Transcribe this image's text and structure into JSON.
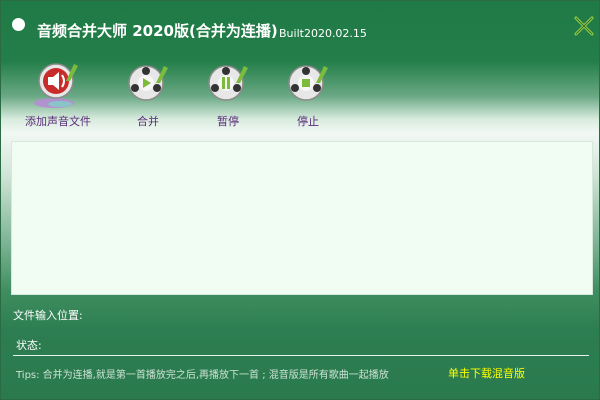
{
  "window": {
    "title": "音频合并大师 2020版(合并为连播)",
    "build": "Built2020.02.15"
  },
  "toolbar": {
    "items": [
      {
        "label": "添加声音文件",
        "icon": "speaker-icon"
      },
      {
        "label": "合并",
        "icon": "merge-play-icon"
      },
      {
        "label": "暂停",
        "icon": "pause-icon"
      },
      {
        "label": "停止",
        "icon": "stop-icon"
      }
    ]
  },
  "fields": {
    "output_path_label": "文件输入位置:",
    "status_label": "状态:"
  },
  "footer": {
    "tips": "Tips: 合并为连播,就是第一首播放完之后,再播放下一首 ; 混音版是所有歌曲一起播放",
    "download_link": "单击下载混音版"
  },
  "colors": {
    "window_green": "#1f7a45",
    "list_background": "#f1fdf3",
    "label_purple": "#5a2a7a",
    "link_yellow": "#ffff00"
  }
}
